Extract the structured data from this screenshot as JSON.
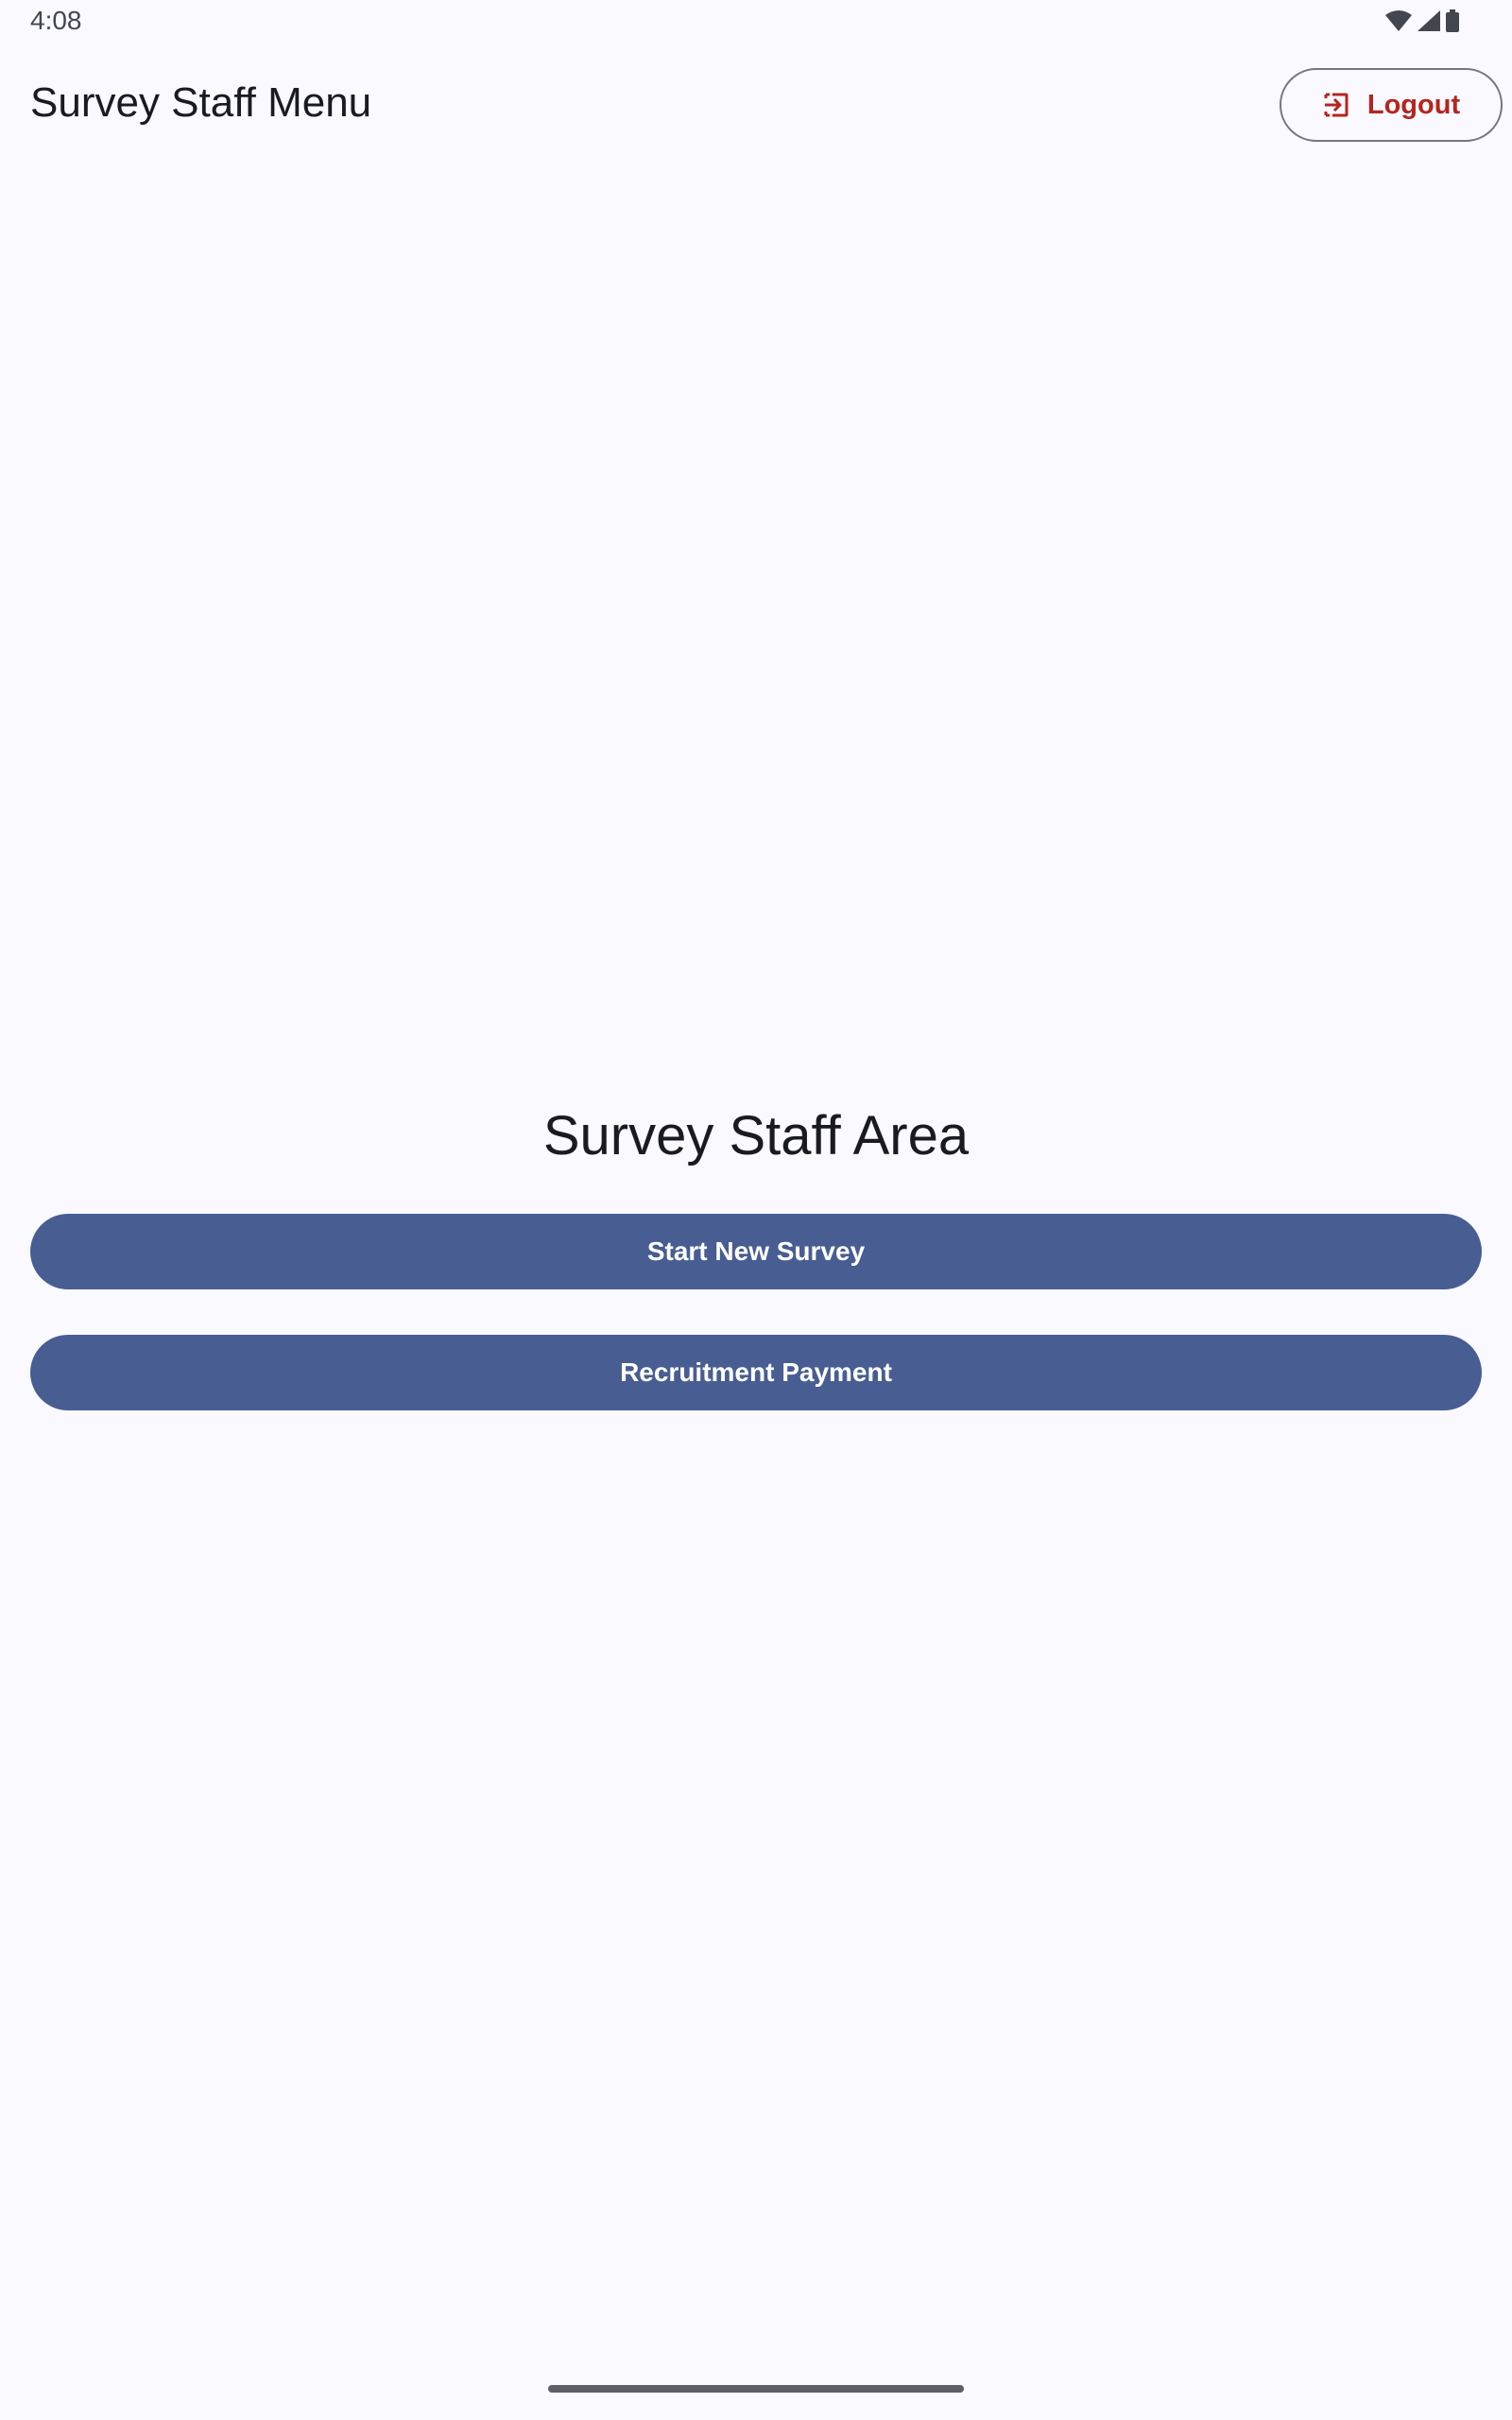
{
  "status_bar": {
    "time": "4:08",
    "icons": [
      "wifi-icon",
      "cell-signal-icon",
      "battery-icon"
    ]
  },
  "top_bar": {
    "title": "Survey Staff Menu",
    "logout_label": "Logout",
    "logout_icon": "logout-icon"
  },
  "main": {
    "heading": "Survey Staff Area",
    "buttons": [
      {
        "label": "Start New Survey"
      },
      {
        "label": "Recruitment Payment"
      }
    ]
  },
  "colors": {
    "background": "#f9f9ff",
    "primary": "#485d92",
    "logout_accent": "#b3261e",
    "outline": "#757680"
  }
}
